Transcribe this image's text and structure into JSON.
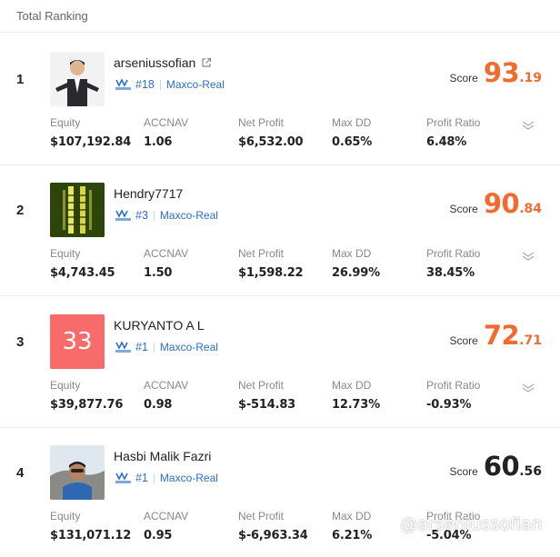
{
  "header": {
    "title": "Total Ranking"
  },
  "colors": {
    "score_top": "#f26a2e",
    "score_normal": "#222222",
    "link_blue": "#2b6fc2",
    "avatar_red": "#f76b6b"
  },
  "columns": [
    "Equity",
    "ACCNAV",
    "Net Profit",
    "Max DD",
    "Profit Ratio"
  ],
  "rows": [
    {
      "rank": "1",
      "name": "arseniussofian",
      "show_link": true,
      "broker_rank": "#18",
      "broker": "Maxco-Real",
      "score_label": "Score",
      "score_int": "93",
      "score_dec": ".19",
      "score_color": "#f26a2e",
      "avatar": "photo-man-suit",
      "stats": [
        "$107,192.84",
        "1.06",
        "$6,532.00",
        "0.65%",
        "6.48%"
      ]
    },
    {
      "rank": "2",
      "name": "Hendry7717",
      "show_link": false,
      "broker_rank": "#3",
      "broker": "Maxco-Real",
      "score_label": "Score",
      "score_int": "90",
      "score_dec": ".84",
      "score_color": "#f26a2e",
      "avatar": "photo-gold-bars",
      "stats": [
        "$4,743.45",
        "1.50",
        "$1,598.22",
        "26.99%",
        "38.45%"
      ]
    },
    {
      "rank": "3",
      "name": "KURYANTO A L",
      "show_link": false,
      "broker_rank": "#1",
      "broker": "Maxco-Real",
      "score_label": "Score",
      "score_int": "72",
      "score_dec": ".71",
      "score_color": "#f26a2e",
      "avatar": "number-tile",
      "avatar_text": "33",
      "stats": [
        "$39,877.76",
        "0.98",
        "$-514.83",
        "12.73%",
        "-0.93%"
      ]
    },
    {
      "rank": "4",
      "name": "Hasbi Malik Fazri",
      "show_link": false,
      "broker_rank": "#1",
      "broker": "Maxco-Real",
      "score_label": "Score",
      "score_int": "60",
      "score_dec": ".56",
      "score_color": "#222222",
      "avatar": "photo-man-outdoor",
      "stats": [
        "$131,071.12",
        "0.95",
        "$-6,963.34",
        "6.21%",
        "-5.04%"
      ]
    }
  ],
  "watermark": "@arseniussofian"
}
